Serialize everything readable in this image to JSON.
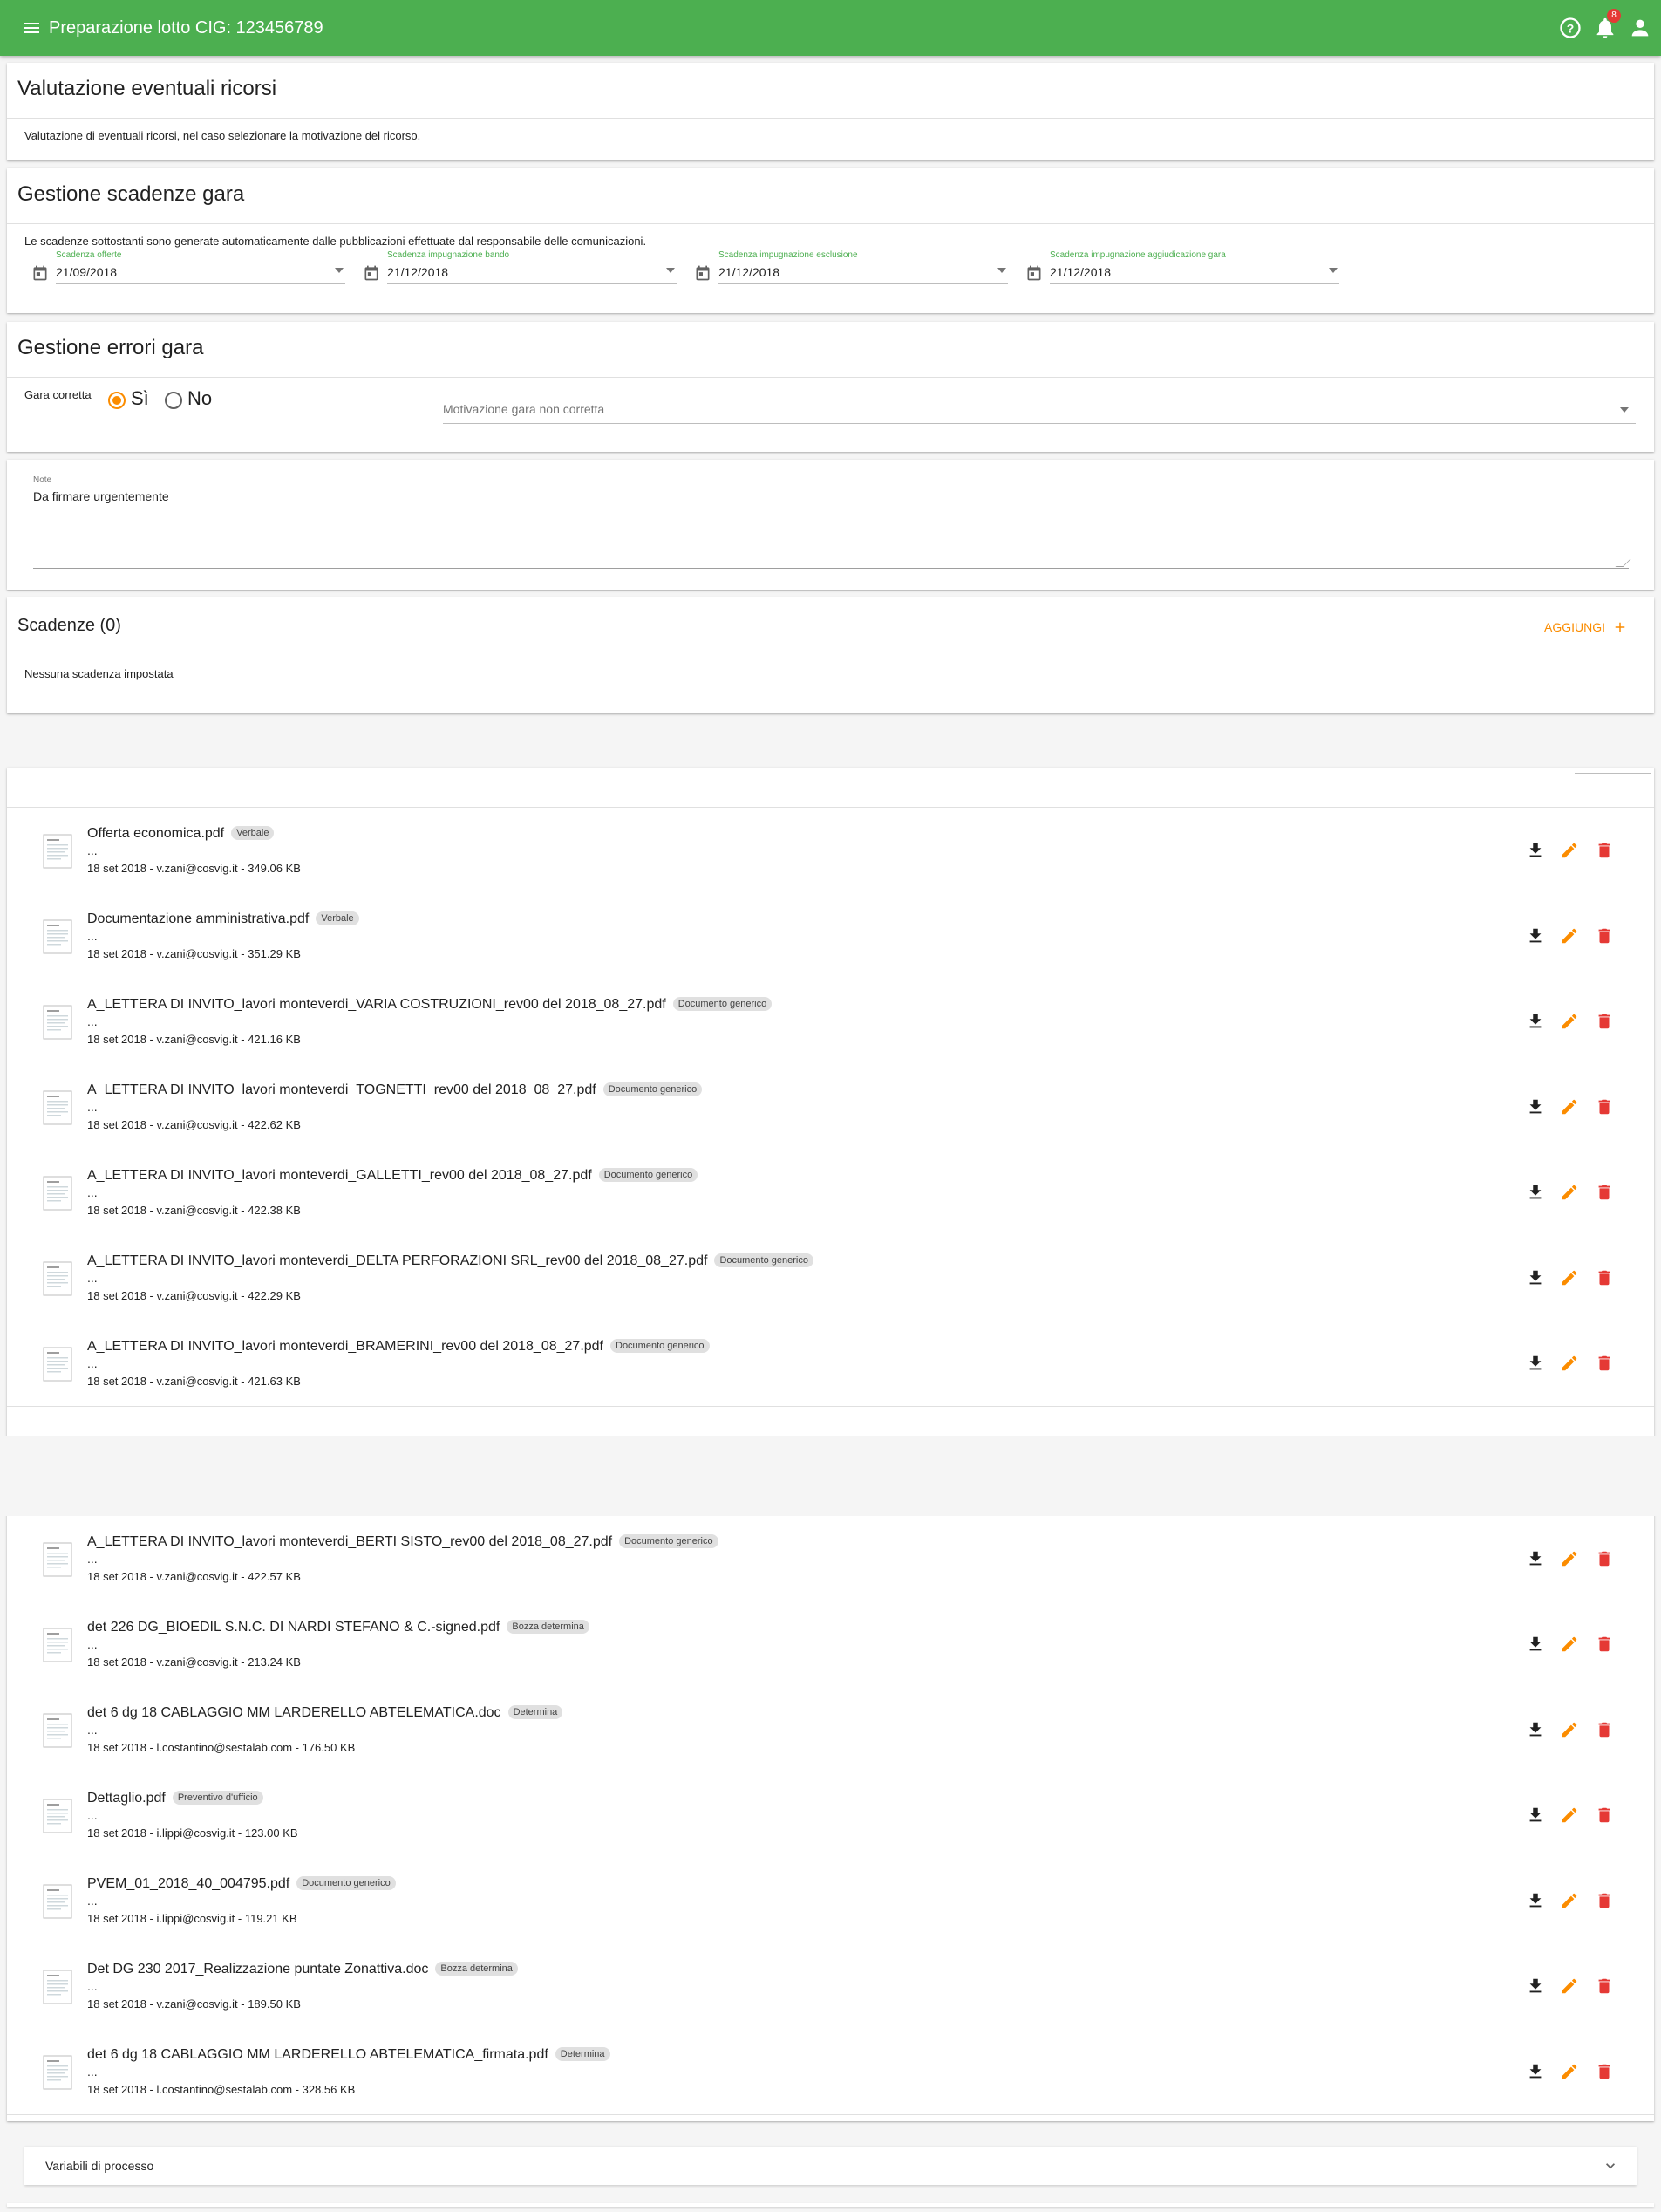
{
  "appbar": {
    "title": "Preparazione lotto CIG: 123456789",
    "notification_count": "8",
    "icons": [
      "menu-icon",
      "help-icon",
      "bell-icon",
      "account-icon"
    ]
  },
  "ricorsi": {
    "title": "Valutazione eventuali ricorsi",
    "description": "Valutazione di eventuali ricorsi, nel caso selezionare la motivazione del ricorso."
  },
  "scadenze_gara": {
    "title": "Gestione scadenze gara",
    "description": "Le scadenze sottostanti sono generate automaticamente dalle pubblicazioni effettuate dal responsabile delle comunicazioni.",
    "fields": [
      {
        "label": "Scadenza offerte",
        "value": "21/09/2018"
      },
      {
        "label": "Scadenza impugnazione bando",
        "value": "21/12/2018"
      },
      {
        "label": "Scadenza impugnazione esclusione",
        "value": "21/12/2018"
      },
      {
        "label": "Scadenza impugnazione aggiudicazione gara",
        "value": "21/12/2018"
      }
    ]
  },
  "errori_gara": {
    "title": "Gestione errori gara",
    "gara_label": "Gara corretta",
    "yes": "Sì",
    "no": "No",
    "selected": "Sì",
    "motivazione_placeholder": "Motivazione gara non corretta"
  },
  "note": {
    "label": "Note",
    "value": "Da firmare urgentemente"
  },
  "scadenze": {
    "title": "Scadenze (0)",
    "add_label": "AGGIUNGI",
    "empty_text": "Nessuna scadenza impostata"
  },
  "documents": [
    {
      "name": "Offerta economica.pdf",
      "tag": "Verbale",
      "desc": "...",
      "meta": "18 set 2018 - v.zani@cosvig.it - 349.06 KB"
    },
    {
      "name": "Documentazione amministrativa.pdf",
      "tag": "Verbale",
      "desc": "...",
      "meta": "18 set 2018 - v.zani@cosvig.it - 351.29 KB"
    },
    {
      "name": "A_LETTERA DI INVITO_lavori monteverdi_VARIA COSTRUZIONI_rev00 del 2018_08_27.pdf",
      "tag": "Documento generico",
      "desc": "...",
      "meta": "18 set 2018 - v.zani@cosvig.it - 421.16 KB"
    },
    {
      "name": "A_LETTERA DI INVITO_lavori monteverdi_TOGNETTI_rev00 del 2018_08_27.pdf",
      "tag": "Documento generico",
      "desc": "...",
      "meta": "18 set 2018 - v.zani@cosvig.it - 422.62 KB"
    },
    {
      "name": "A_LETTERA DI INVITO_lavori monteverdi_GALLETTI_rev00 del 2018_08_27.pdf",
      "tag": "Documento generico",
      "desc": "...",
      "meta": "18 set 2018 - v.zani@cosvig.it - 422.38 KB"
    },
    {
      "name": "A_LETTERA DI INVITO_lavori monteverdi_DELTA PERFORAZIONI SRL_rev00 del 2018_08_27.pdf",
      "tag": "Documento generico",
      "desc": "...",
      "meta": "18 set 2018 - v.zani@cosvig.it - 422.29 KB"
    },
    {
      "name": "A_LETTERA DI INVITO_lavori monteverdi_BRAMERINI_rev00 del 2018_08_27.pdf",
      "tag": "Documento generico",
      "desc": "...",
      "meta": "18 set 2018 - v.zani@cosvig.it - 421.63 KB"
    },
    {
      "name": "A_LETTERA DI INVITO_lavori monteverdi_BERTI SISTO_rev00 del 2018_08_27.pdf",
      "tag": "Documento generico",
      "desc": "...",
      "meta": "18 set 2018 - v.zani@cosvig.it - 422.57 KB"
    },
    {
      "name": "det 226 DG_BIOEDIL S.N.C. DI NARDI STEFANO & C.-signed.pdf",
      "tag": "Bozza determina",
      "desc": "...",
      "meta": "18 set 2018 - v.zani@cosvig.it - 213.24 KB"
    },
    {
      "name": "det 6 dg 18 CABLAGGIO MM LARDERELLO ABTELEMATICA.doc",
      "tag": "Determina",
      "desc": "...",
      "meta": "18 set 2018 - l.costantino@sestalab.com - 176.50 KB"
    },
    {
      "name": "Dettaglio.pdf",
      "tag": "Preventivo d'ufficio",
      "desc": "...",
      "meta": "18 set 2018 - i.lippi@cosvig.it - 123.00 KB"
    },
    {
      "name": "PVEM_01_2018_40_004795.pdf",
      "tag": "Documento generico",
      "desc": "...",
      "meta": "18 set 2018 - i.lippi@cosvig.it - 119.21 KB"
    },
    {
      "name": "Det DG 230 2017_Realizzazione puntate Zonattiva.doc",
      "tag": "Bozza determina",
      "desc": "...",
      "meta": "18 set 2018 - v.zani@cosvig.it - 189.50 KB"
    },
    {
      "name": "det 6 dg 18 CABLAGGIO MM LARDERELLO ABTELEMATICA_firmata.pdf",
      "tag": "Determina",
      "desc": "...",
      "meta": "18 set 2018 - l.costantino@sestalab.com - 328.56 KB"
    }
  ],
  "variabili": {
    "title": "Variabili di processo"
  },
  "colors": {
    "primary": "#4caf50",
    "accent": "#fb8c00",
    "delete": "#e53935"
  }
}
